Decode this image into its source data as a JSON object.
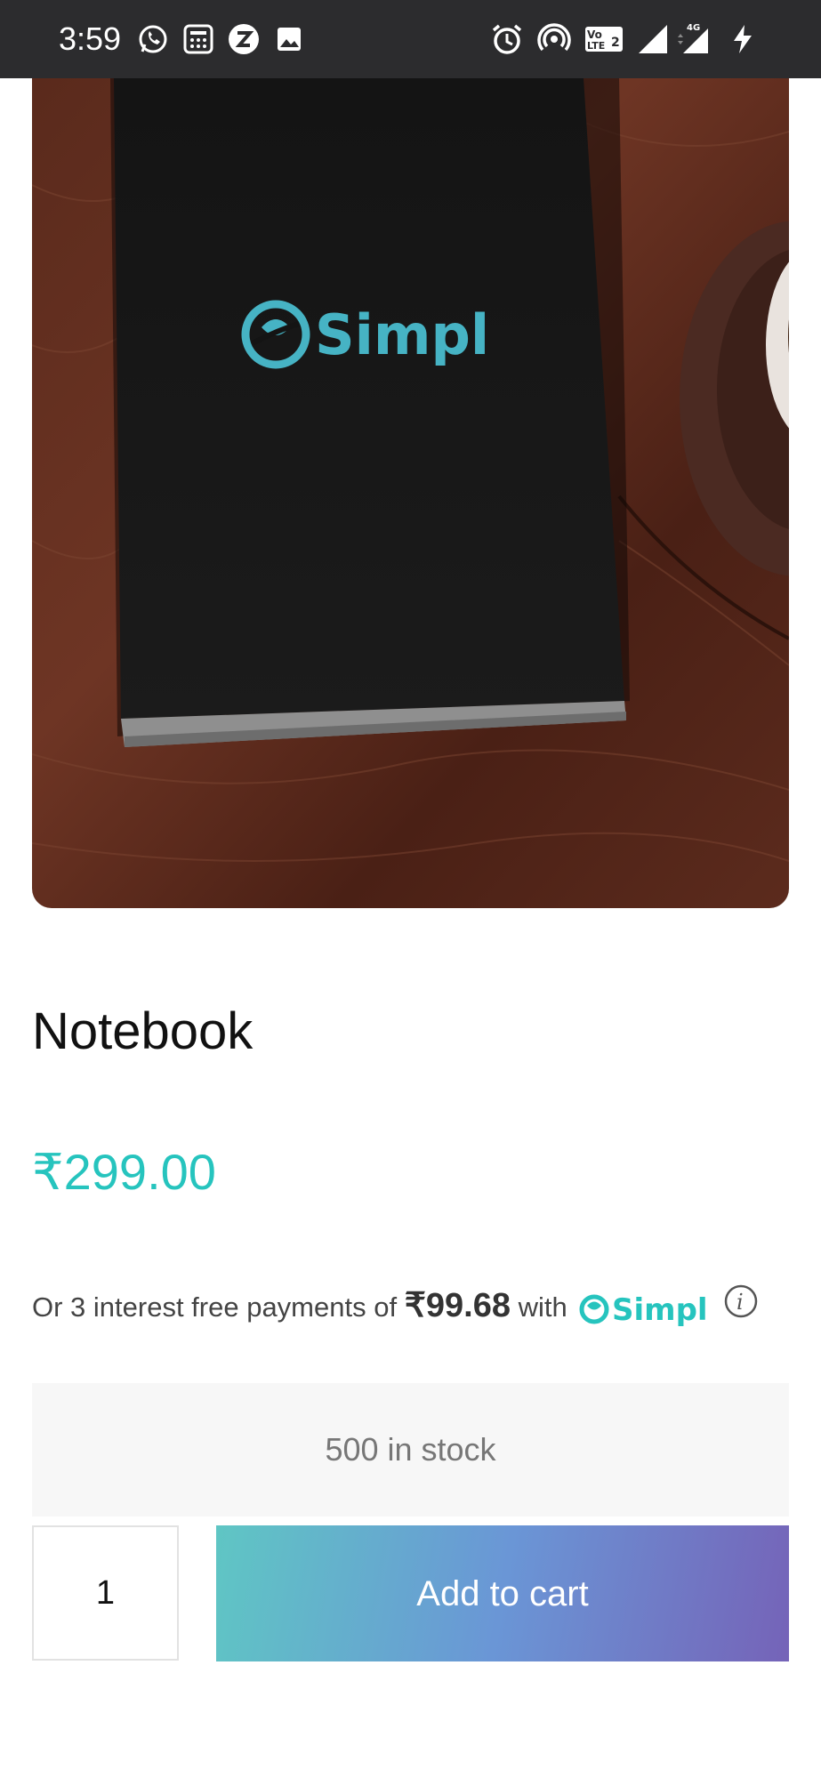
{
  "status_bar": {
    "time": "3:59",
    "left_icons": [
      "whatsapp-icon",
      "calculator-icon",
      "zepto-icon",
      "gallery-icon"
    ],
    "right_icons": [
      "alarm-icon",
      "hotspot-icon",
      "volte-icon",
      "signal-icon",
      "signal-4g-icon",
      "charging-icon"
    ],
    "volte_label": "Vo LTE2",
    "network_label": "4G"
  },
  "product": {
    "image_logo_text": "Simpl",
    "title": "Notebook",
    "price": "₹299.00",
    "price_color": "#26c4be"
  },
  "bnpl": {
    "prefix": "Or 3 interest free payments of",
    "amount": "₹99.68",
    "with_text": "with",
    "brand": "Simpl",
    "info_icon": "info-icon",
    "brand_color": "#26c4be"
  },
  "stock": {
    "text": "500 in stock"
  },
  "cart": {
    "quantity": "1",
    "add_label": "Add to cart"
  }
}
